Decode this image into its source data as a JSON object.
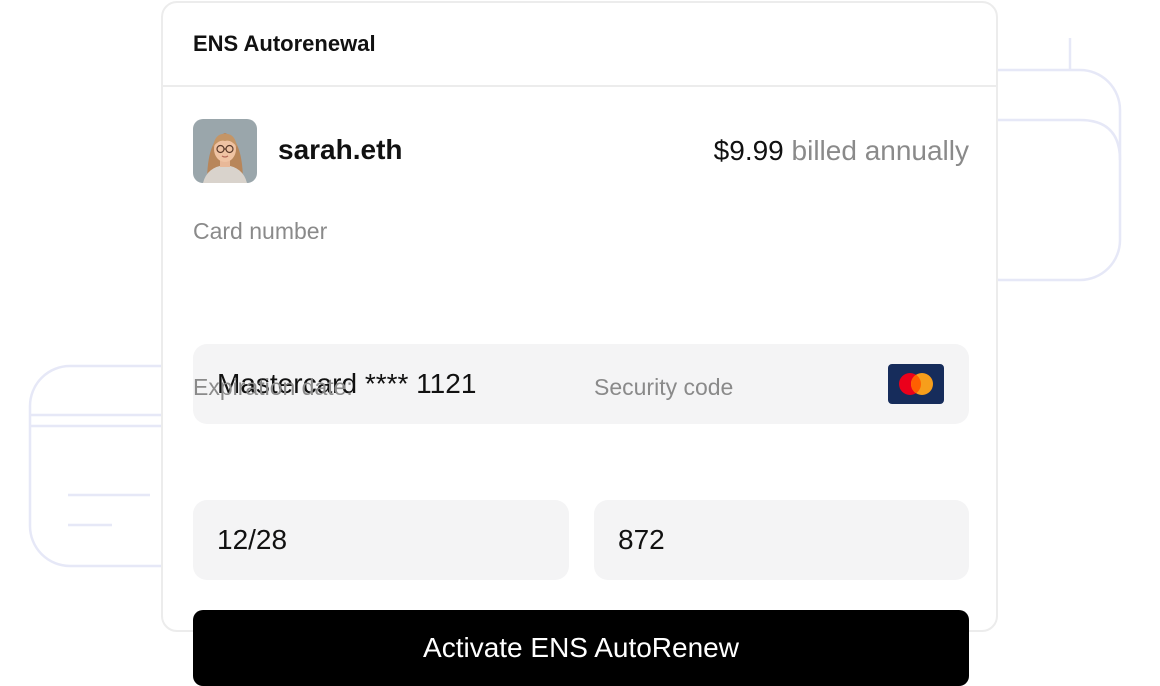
{
  "dialog": {
    "title": "ENS Autorenewal",
    "account": {
      "name": "sarah.eth",
      "price": "$9.99",
      "billing": "billed annually"
    },
    "card_number": {
      "label": "Card number",
      "value": "Mastercard **** 1121",
      "brand_icon": "mastercard-icon"
    },
    "expiration": {
      "label": "Expiration date:",
      "value": "12/28"
    },
    "security_code": {
      "label": "Security code",
      "value": "872"
    },
    "submit_label": "Activate ENS AutoRenew"
  },
  "colors": {
    "button_bg": "#000000",
    "field_bg": "#f4f4f5",
    "muted_text": "#8a8a8a",
    "decoration_stroke": "#e6e8f7",
    "mastercard_bg": "#162c5b",
    "mastercard_red": "#eb001b",
    "mastercard_orange": "#f79e1b"
  }
}
